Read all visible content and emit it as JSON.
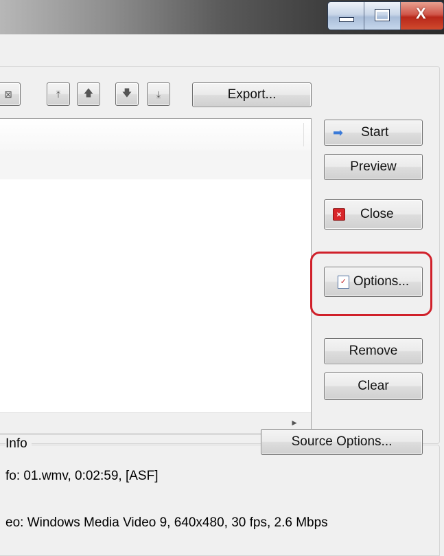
{
  "window": {
    "caption_buttons": {
      "minimize_icon": "minimize-icon",
      "maximize_icon": "maximize-icon",
      "close_icon": "close-icon",
      "close_glyph": "X"
    }
  },
  "toolbar": {
    "export_label": "Export...",
    "icons": [
      "list-view-icon",
      "move-to-top-icon",
      "move-up-icon",
      "move-down-icon",
      "move-to-bottom-icon"
    ],
    "glyphs": {
      "list_view": "⊠",
      "move_top": "⤒",
      "move_up": "🡅",
      "move_down": "🡇",
      "move_bottom": "⤓"
    }
  },
  "actions": {
    "start_label": "Start",
    "preview_label": "Preview",
    "close_label": "Close",
    "options_label": "Options...",
    "remove_label": "Remove",
    "clear_label": "Clear",
    "start_glyph": "➡",
    "close_glyph": "×",
    "options_glyph": "✓"
  },
  "source": {
    "group_title": "Info",
    "options_button_label": "Source Options...",
    "info_line": "fo:  01.wmv, 0:02:59,  [ASF]",
    "video_line": "eo:  Windows Media Video 9, 640x480, 30 fps, 2.6 Mbps"
  },
  "accent": {
    "highlight_ring": "#d0202a",
    "start_arrow": "#3a7ad8",
    "close_icon": "#d8262a"
  }
}
